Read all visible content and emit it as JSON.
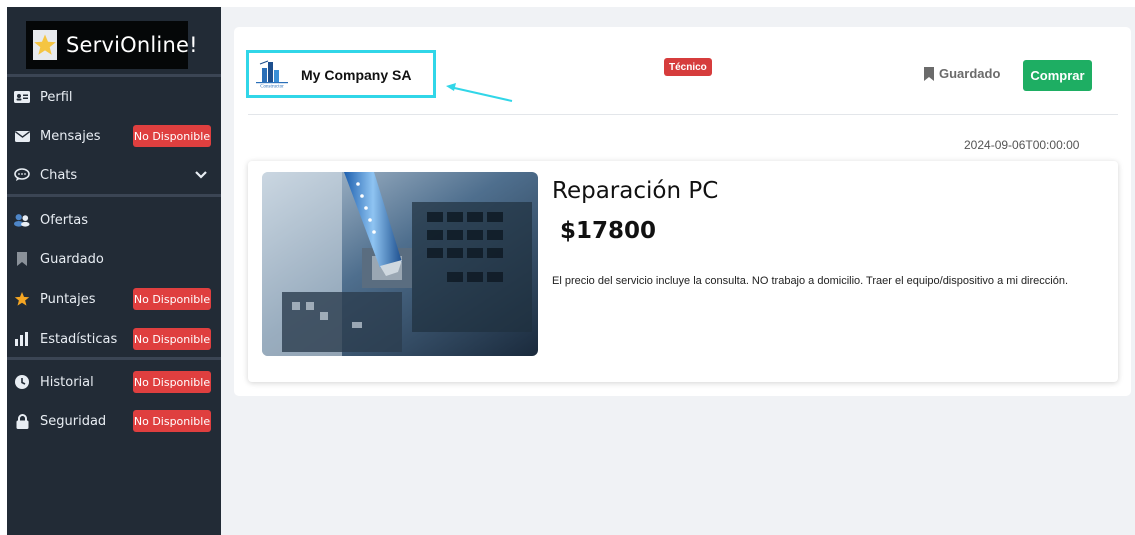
{
  "sidebar": {
    "brand": {
      "title": "ServiOnline!",
      "icon": "star-icon"
    },
    "items": [
      {
        "label": "Perfil",
        "icon": "id-card-icon",
        "badge": ""
      },
      {
        "label": "Mensajes",
        "icon": "envelope-icon",
        "badge": "No Disponible"
      },
      {
        "label": "Chats",
        "icon": "chat-bubble-icon",
        "badge": "",
        "expandable": true
      },
      {
        "label": "Ofertas",
        "icon": "users-icon",
        "badge": ""
      },
      {
        "label": "Guardado",
        "icon": "bookmark-icon",
        "badge": ""
      },
      {
        "label": "Puntajes",
        "icon": "star-icon",
        "badge": "No Disponible"
      },
      {
        "label": "Estadísticas",
        "icon": "bar-chart-icon",
        "badge": "No Disponible"
      },
      {
        "label": "Historial",
        "icon": "clock-icon",
        "badge": "No Disponible"
      },
      {
        "label": "Seguridad",
        "icon": "lock-icon",
        "badge": "No Disponible"
      }
    ]
  },
  "header": {
    "company_name": "My Company SA",
    "company_logo_text": "Constructor",
    "category_badge": "Técnico",
    "saved_label": "Guardado",
    "buy_label": "Comprar"
  },
  "listing": {
    "date": "2024-09-06T00:00:00",
    "title": "Reparación PC",
    "price": "$17800",
    "description": "El precio del servicio incluye la consulta. NO trabajo a domicilio. Traer el equipo/dispositivo a mi dirección."
  },
  "colors": {
    "sidebar_bg": "#222b36",
    "badge_red": "#df3f3f",
    "buy_green": "#1eae63",
    "highlight_cyan": "#31d6e8"
  }
}
